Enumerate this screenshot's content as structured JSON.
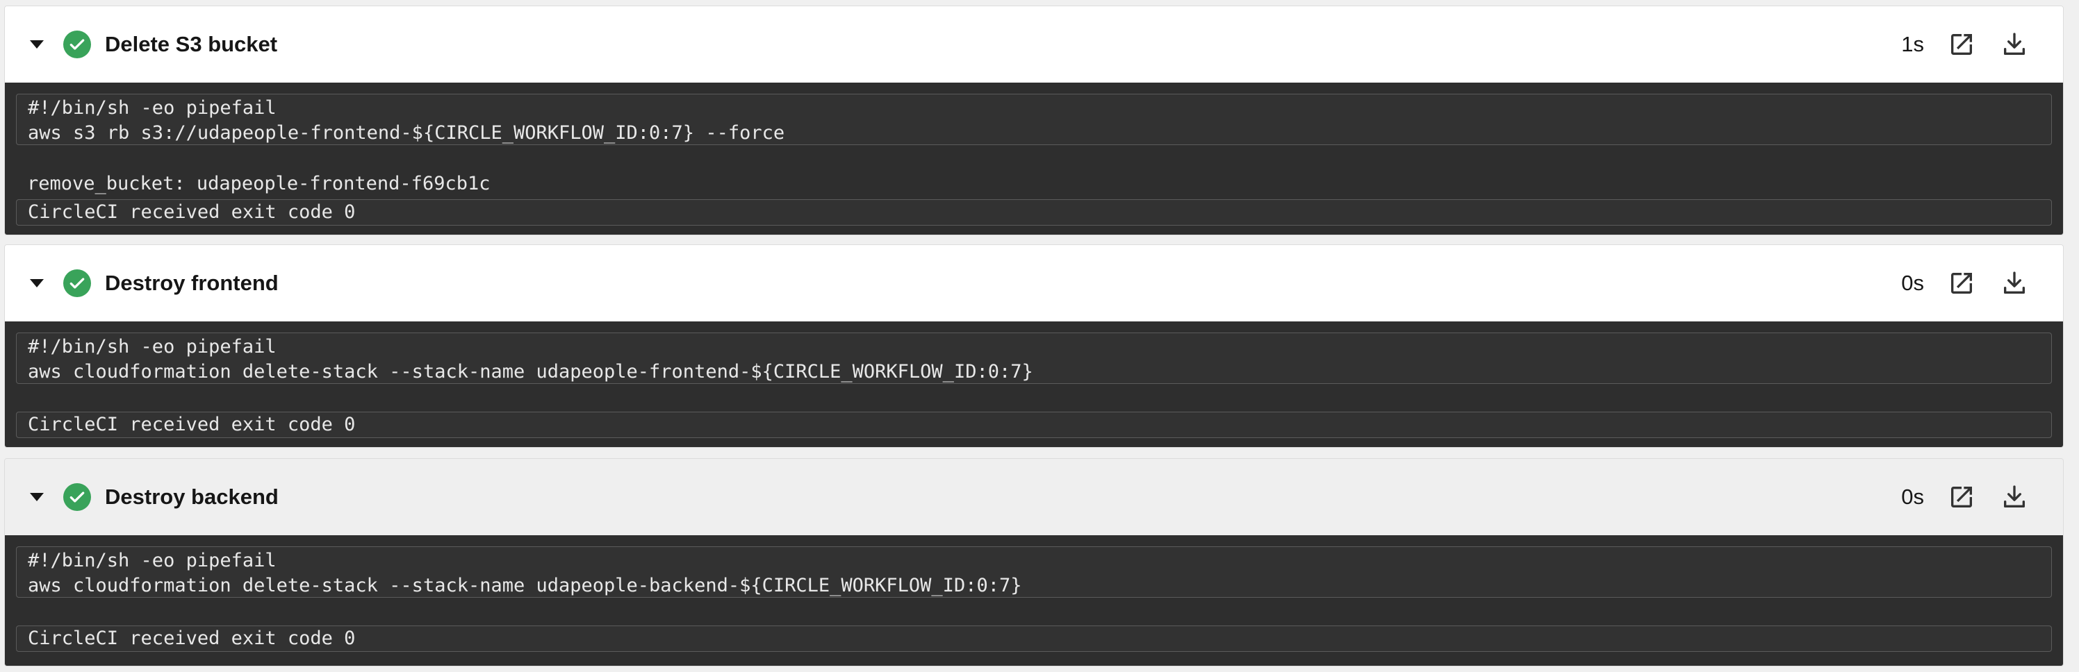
{
  "steps": [
    {
      "title": "Delete S3 bucket",
      "duration": "1s",
      "status": "success",
      "command": [
        "#!/bin/sh -eo pipefail",
        "aws s3 rb s3://udapeople-frontend-${CIRCLE_WORKFLOW_ID:0:7} --force"
      ],
      "output": [
        "remove_bucket: udapeople-frontend-f69cb1c"
      ],
      "exit_message": "CircleCI received exit code 0"
    },
    {
      "title": "Destroy frontend",
      "duration": "0s",
      "status": "success",
      "command": [
        "#!/bin/sh -eo pipefail",
        "aws cloudformation delete-stack --stack-name udapeople-frontend-${CIRCLE_WORKFLOW_ID:0:7}"
      ],
      "output": [],
      "exit_message": "CircleCI received exit code 0"
    },
    {
      "title": "Destroy backend",
      "duration": "0s",
      "status": "success",
      "command": [
        "#!/bin/sh -eo pipefail",
        "aws cloudformation delete-stack --stack-name udapeople-backend-${CIRCLE_WORKFLOW_ID:0:7}"
      ],
      "output": [],
      "exit_message": "CircleCI received exit code 0"
    }
  ],
  "icons": {
    "expand": "chevron-down-icon",
    "status": "check-circle-icon",
    "open": "open-in-new-icon",
    "download": "download-icon"
  },
  "colors": {
    "success": "#39a35a",
    "terminal_bg": "#2e2e2e",
    "terminal_text": "#e8e8e8",
    "header_bg": "#ffffff"
  }
}
